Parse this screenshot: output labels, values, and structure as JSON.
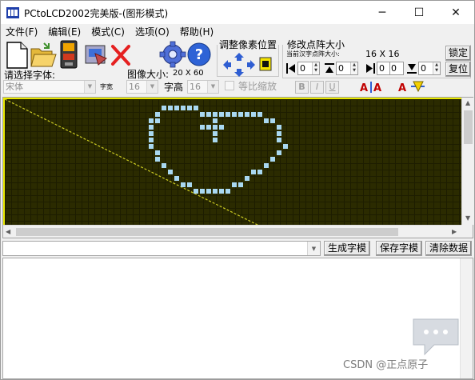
{
  "window": {
    "title": "PCtoLCD2002完美版-(图形模式)",
    "controls": {
      "minimize": "─",
      "maximize": "☐",
      "close": "✕"
    }
  },
  "menu": [
    "文件(F)",
    "编辑(E)",
    "模式(C)",
    "选项(O)",
    "帮助(H)"
  ],
  "toolbar": {
    "icons": [
      "new-file-icon",
      "open-folder-icon",
      "save-icon",
      "export-icon",
      "delete-icon",
      "settings-gear-icon",
      "help-icon"
    ],
    "font_label": "请选择字体:",
    "font_value": "宋体",
    "width_label": "字宽",
    "width_value": "16",
    "height_label": "字高",
    "height_value": "16",
    "image_size_label": "图像大小:",
    "image_size_value": "20 X 60",
    "proportional_label": "等比缩放",
    "bold": "B",
    "italic": "I",
    "underline": "U"
  },
  "adjust": {
    "title": "调整像素位置"
  },
  "resize": {
    "title": "修改点阵大小",
    "current_label": "当前汉字点阵大小:",
    "current_value": "16 X 16",
    "lock_label": "锁定",
    "reset_label": "复位",
    "spins": [
      "0",
      "0",
      "0",
      "0",
      "0",
      "0"
    ]
  },
  "bottom": {
    "generate_label": "生成字模",
    "save_label": "保存字模",
    "clear_label": "清除数据"
  },
  "watermark": "CSDN @正点原子",
  "colors": {
    "grid_bg": "#2b2b00",
    "pixel_on": "#a9d8f1",
    "border_yellow": "#e9e900"
  }
}
